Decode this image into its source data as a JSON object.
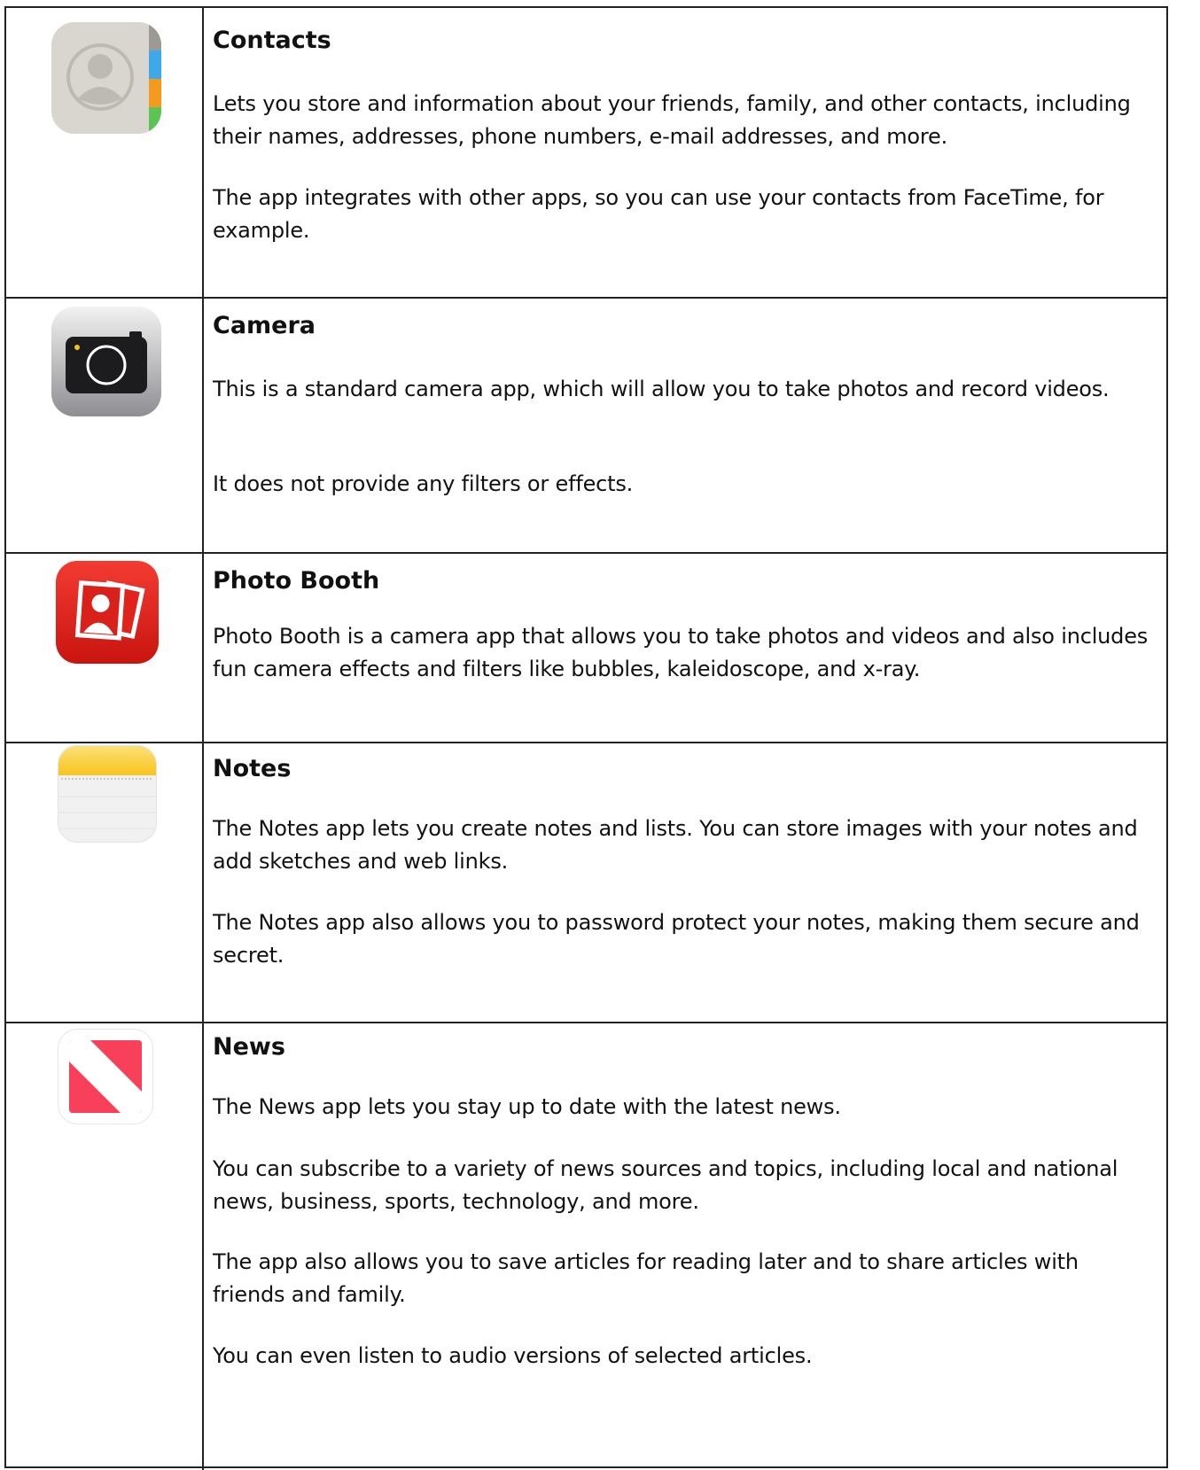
{
  "rows": [
    {
      "title": "Contacts",
      "icon": "contacts-icon",
      "paragraphs": [
        "Lets you store and information about your friends, family, and other contacts, including their names, addresses, phone numbers, e-mail addresses, and more.",
        "The app integrates with other apps, so you can use your contacts from FaceTime, for example."
      ]
    },
    {
      "title": "Camera",
      "icon": "camera-icon",
      "paragraphs": [
        "This is a standard camera app, which will allow you to take photos and record videos.",
        "It does not provide any filters or effects."
      ]
    },
    {
      "title": "Photo Booth",
      "icon": "photo-booth-icon",
      "paragraphs": [
        "Photo Booth is a camera app that allows you to take photos and videos and also includes fun camera effects and filters like bubbles, kaleidoscope, and x-ray."
      ]
    },
    {
      "title": "Notes",
      "icon": "notes-icon",
      "paragraphs": [
        "The Notes app lets you create notes and lists. You can store images with your notes and add sketches and web links.",
        "The Notes app also allows you to password protect your notes, making them secure and secret."
      ]
    },
    {
      "title": "News",
      "icon": "news-icon",
      "paragraphs": [
        "The News app lets you stay up to date with the latest news.",
        "You can subscribe to a variety of news sources and topics, including local and national news, business, sports, technology, and more.",
        "The app also allows you to save articles for reading later and to share articles with friends and family.",
        "You can even listen to audio versions of selected articles."
      ]
    }
  ]
}
